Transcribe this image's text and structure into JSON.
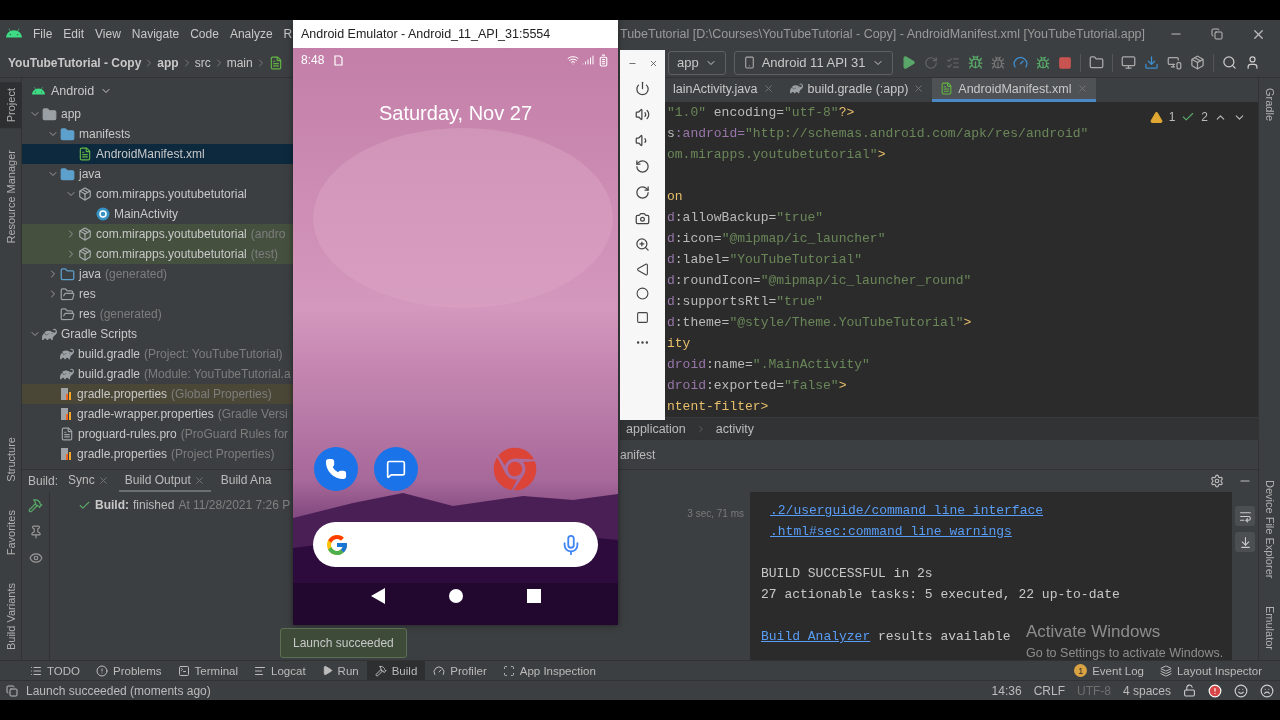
{
  "menu_bar": {
    "menus": [
      "File",
      "Edit",
      "View",
      "Navigate",
      "Code",
      "Analyze",
      "R"
    ],
    "window_title": "TubeTutorial [D:\\Courses\\YouTubeTutorial - Copy] - AndroidManifest.xml [YouTubeTutorial.app]"
  },
  "navigation_bar": {
    "breadcrumbs": [
      "YouTubeTutorial - Copy",
      "app",
      "src",
      "main"
    ],
    "module_selector": "app",
    "device_selector": "Android 11 API 31"
  },
  "left_stripe": {
    "top": [
      {
        "label": "Project",
        "selected": true
      },
      {
        "label": "Resource Manager",
        "selected": false
      }
    ],
    "bottom": [
      {
        "label": "Structure",
        "selected": false
      },
      {
        "label": "Favorites",
        "selected": false
      },
      {
        "label": "Build Variants",
        "selected": false
      }
    ]
  },
  "right_stripe": {
    "top": [
      {
        "label": "Gradle"
      }
    ],
    "bottom": [
      {
        "label": "Device File Explorer"
      },
      {
        "label": "Emulator"
      }
    ]
  },
  "project_panel": {
    "view": "Android",
    "tree": [
      {
        "label": "app",
        "kind": "module",
        "expanded": true,
        "selected": false,
        "children": [
          {
            "label": "manifests",
            "kind": "folder",
            "expanded": true,
            "selected": false,
            "children": [
              {
                "label": "AndroidManifest.xml",
                "kind": "manifest",
                "selected": true
              }
            ]
          },
          {
            "label": "java",
            "kind": "folder",
            "expanded": true,
            "selected": false,
            "children": [
              {
                "label": "com.mirapps.youtubetutorial",
                "kind": "package",
                "expanded": true,
                "selected": false,
                "children": [
                  {
                    "label": "MainActivity",
                    "kind": "class",
                    "selected": false
                  }
                ]
              },
              {
                "label": "com.mirapps.youtubetutorial",
                "hint": "(andro",
                "kind": "package",
                "expanded": false,
                "selected": false,
                "color": "#45503f"
              },
              {
                "label": "com.mirapps.youtubetutorial",
                "hint": "(test)",
                "kind": "package",
                "expanded": false,
                "selected": false,
                "color": "#45503f"
              }
            ]
          },
          {
            "label": "java",
            "hint": "(generated)",
            "kind": "generated-folder",
            "expanded": false,
            "selected": false
          },
          {
            "label": "res",
            "kind": "res-folder",
            "expanded": false,
            "selected": false
          },
          {
            "label": "res",
            "hint": "(generated)",
            "kind": "res-folder",
            "selected": false
          }
        ]
      },
      {
        "label": "Gradle Scripts",
        "kind": "gradle-group",
        "expanded": true,
        "selected": false,
        "children": [
          {
            "label": "build.gradle",
            "hint": "(Project: YouTubeTutorial)",
            "kind": "gradle",
            "selected": false
          },
          {
            "label": "build.gradle",
            "hint": "(Module: YouTubeTutorial.a",
            "kind": "gradle",
            "selected": false
          },
          {
            "label": "gradle.properties",
            "hint": "(Global Properties)",
            "kind": "properties",
            "selected": false,
            "color": "#4a4737"
          },
          {
            "label": "gradle-wrapper.properties",
            "hint": "(Gradle Versi",
            "kind": "properties",
            "selected": false
          },
          {
            "label": "proguard-rules.pro",
            "hint": "(ProGuard Rules for",
            "kind": "file",
            "selected": false
          },
          {
            "label": "gradle.properties",
            "hint": "(Project Properties)",
            "kind": "properties",
            "selected": false
          }
        ]
      }
    ]
  },
  "editor": {
    "tabs": [
      {
        "label": "lainActivity.java",
        "kind": "hidden-icon",
        "selected": false
      },
      {
        "label": "build.gradle (:app)",
        "kind": "gradle",
        "selected": false
      },
      {
        "label": "AndroidManifest.xml",
        "kind": "manifest",
        "selected": true
      }
    ],
    "inspections": {
      "warnings": "1",
      "weak_warnings": "2"
    },
    "lines": [
      {
        "kind": "code",
        "segments": [
          {
            "text": "\"1.0\"",
            "kind": "value"
          },
          {
            "text": " encoding=",
            "kind": "attr"
          },
          {
            "text": "\"utf-8\"",
            "kind": "value"
          },
          {
            "text": "?>",
            "kind": "tag"
          }
        ]
      },
      {
        "kind": "code",
        "segments": [
          {
            "text": "s",
            "kind": "attr"
          },
          {
            "text": ":android=",
            "kind": "ns"
          },
          {
            "text": "\"http://schemas.android.com/apk/res/android\"",
            "kind": "value"
          }
        ]
      },
      {
        "kind": "code",
        "segments": [
          {
            "text": "om.mirapps.youtubetutorial\"",
            "kind": "value"
          },
          {
            "text": ">",
            "kind": "tag"
          }
        ]
      },
      {
        "kind": "blank"
      },
      {
        "kind": "code",
        "segments": [
          {
            "text": "on",
            "kind": "tag"
          }
        ]
      },
      {
        "kind": "code",
        "segments": [
          {
            "text": "d",
            "kind": "ns"
          },
          {
            "text": ":allowBackup=",
            "kind": "attr"
          },
          {
            "text": "\"true\"",
            "kind": "value"
          }
        ]
      },
      {
        "kind": "code",
        "segments": [
          {
            "text": "d",
            "kind": "ns"
          },
          {
            "text": ":icon=",
            "kind": "attr"
          },
          {
            "text": "\"@mipmap/ic_launcher\"",
            "kind": "value"
          }
        ]
      },
      {
        "kind": "code",
        "segments": [
          {
            "text": "d",
            "kind": "ns"
          },
          {
            "text": ":label=",
            "kind": "attr"
          },
          {
            "text": "\"YouTubeTutorial\"",
            "kind": "value"
          }
        ]
      },
      {
        "kind": "code",
        "segments": [
          {
            "text": "d",
            "kind": "ns"
          },
          {
            "text": ":roundIcon=",
            "kind": "attr"
          },
          {
            "text": "\"@mipmap/ic_launcher_round\"",
            "kind": "value"
          }
        ]
      },
      {
        "kind": "code",
        "segments": [
          {
            "text": "d",
            "kind": "ns"
          },
          {
            "text": ":supportsRtl=",
            "kind": "attr"
          },
          {
            "text": "\"true\"",
            "kind": "value"
          }
        ]
      },
      {
        "kind": "code",
        "segments": [
          {
            "text": "d",
            "kind": "ns"
          },
          {
            "text": ":theme=",
            "kind": "attr"
          },
          {
            "text": "\"@style/Theme.YouTubeTutorial\"",
            "kind": "value"
          },
          {
            "text": ">",
            "kind": "tag"
          }
        ]
      },
      {
        "kind": "code",
        "segments": [
          {
            "text": "ity",
            "kind": "tag"
          }
        ]
      },
      {
        "kind": "code",
        "segments": [
          {
            "text": "droid",
            "kind": "ns"
          },
          {
            "text": ":name=",
            "kind": "attr"
          },
          {
            "text": "\".MainActivity\"",
            "kind": "value"
          }
        ]
      },
      {
        "kind": "code",
        "segments": [
          {
            "text": "droid",
            "kind": "ns"
          },
          {
            "text": ":exported=",
            "kind": "attr"
          },
          {
            "text": "\"false\"",
            "kind": "value"
          },
          {
            "text": ">",
            "kind": "tag"
          }
        ]
      },
      {
        "kind": "code",
        "segments": [
          {
            "text": "ntent-filter>",
            "kind": "tag"
          }
        ]
      }
    ],
    "breadcrumbs": [
      "application",
      "activity"
    ],
    "bottom_tab": "anifest"
  },
  "build_panel": {
    "title": "Build:",
    "tabs": [
      {
        "label": "Sync",
        "selected": false,
        "closable": true
      },
      {
        "label": "Build Output",
        "selected": true,
        "closable": true
      },
      {
        "label": "Build Ana",
        "selected": false,
        "closable": false
      }
    ],
    "result": {
      "status": "Build:",
      "text": "finished",
      "detail": "At 11/28/2021 7:26 P"
    },
    "duration": "3 sec, 71 ms",
    "console": [
      {
        "kind": "text",
        "indent": true,
        "segments": [
          {
            "text": ".2/userguide/command_line_interface",
            "kind": "link"
          }
        ]
      },
      {
        "kind": "text",
        "indent": true,
        "segments": [
          {
            "text": ".html#sec:command_line_warnings",
            "kind": "link"
          }
        ]
      },
      {
        "kind": "blank"
      },
      {
        "kind": "text",
        "indent": false,
        "segments": [
          {
            "text": "BUILD SUCCESSFUL in 2s",
            "kind": "plain"
          }
        ]
      },
      {
        "kind": "text",
        "indent": false,
        "segments": [
          {
            "text": "27 actionable tasks: 5 executed, 22 up-to-date",
            "kind": "plain"
          }
        ]
      },
      {
        "kind": "blank"
      },
      {
        "kind": "text",
        "indent": false,
        "segments": [
          {
            "text": "Build Analyzer",
            "kind": "link"
          },
          {
            "text": " results available",
            "kind": "plain"
          }
        ]
      }
    ]
  },
  "tool_windows": [
    {
      "label": "TODO",
      "kind": "todo",
      "selected": false
    },
    {
      "label": "Problems",
      "kind": "problems",
      "selected": false
    },
    {
      "label": "Terminal",
      "kind": "terminal",
      "selected": false
    },
    {
      "label": "Logcat",
      "kind": "logcat",
      "selected": false
    },
    {
      "label": "Run",
      "kind": "run",
      "selected": false
    },
    {
      "label": "Build",
      "kind": "build",
      "selected": true
    },
    {
      "label": "Profiler",
      "kind": "profiler",
      "selected": false
    },
    {
      "label": "App Inspection",
      "kind": "inspection",
      "selected": false
    }
  ],
  "tool_windows_right": [
    {
      "label": "Event Log",
      "kind": "event-log",
      "badge": "1"
    },
    {
      "label": "Layout Inspector",
      "kind": "layout-inspector"
    }
  ],
  "status_bar": {
    "message": "Launch succeeded (moments ago)",
    "position": "14:36",
    "line_separator": "CRLF",
    "encoding": "UTF-8",
    "indent": "4 spaces"
  },
  "emulator": {
    "title": "Android Emulator - Android_11_API_31:5554",
    "time": "8:48",
    "date": "Saturday, Nov 27"
  },
  "notification": {
    "text": "Launch succeeded"
  },
  "os_watermark": {
    "title": "Activate Windows",
    "subtitle": "Go to Settings to activate Windows."
  }
}
